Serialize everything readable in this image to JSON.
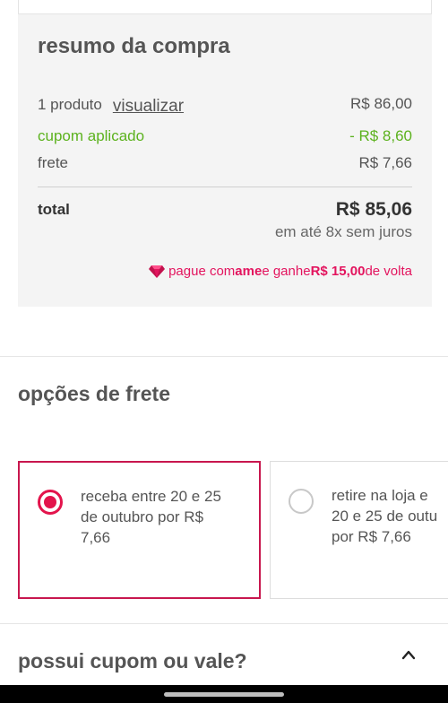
{
  "summary": {
    "title": "resumo da compra",
    "products_label": "1 produto",
    "view_link": "visualizar",
    "products_value": "R$ 86,00",
    "coupon_label": "cupom aplicado",
    "coupon_value": "- R$ 8,60",
    "shipping_label": "frete",
    "shipping_value": "R$ 7,66",
    "total_label": "total",
    "total_value": "R$ 85,06",
    "installments": "em até 8x sem juros",
    "ame": {
      "pre": "pague com ",
      "brand": "ame",
      "mid": " e ganhe ",
      "amount": "R$ 15,00",
      "post": " de volta",
      "icon": "ame-diamond-icon"
    }
  },
  "shipping_options": {
    "title": "opções de frete",
    "options": [
      {
        "text": "receba entre 20 e 25\nde outubro por R$\n7,66",
        "selected": true
      },
      {
        "text": "retire na loja e\n20 e 25 de outu\npor R$ 7,66",
        "selected": false
      }
    ]
  },
  "coupon": {
    "title": "possui cupom ou vale?",
    "icon": "chevron-up-icon"
  },
  "colors": {
    "accent": "#e3144c",
    "coupon_green": "#5cb21e",
    "ame_pink": "#e3145e"
  }
}
